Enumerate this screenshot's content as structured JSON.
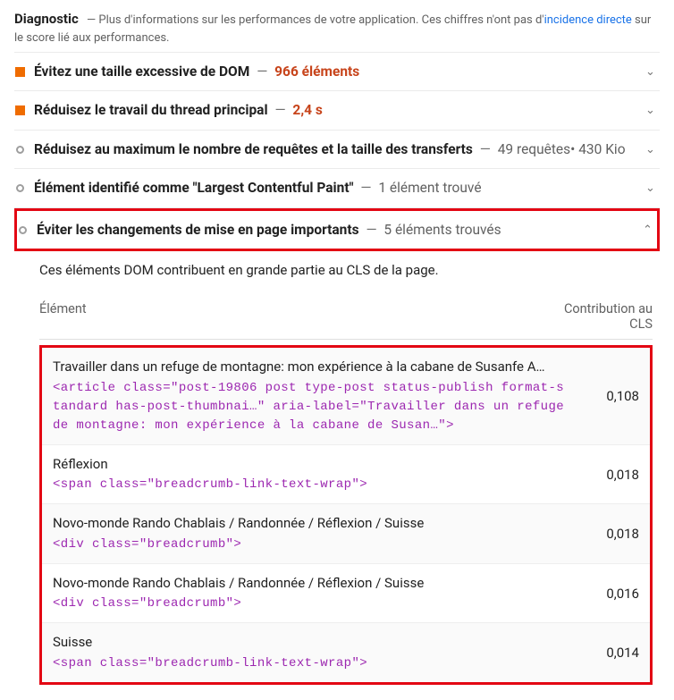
{
  "header": {
    "title": "Diagnostic",
    "sep": "—",
    "text_a": "Plus d'informations sur les performances de votre application. Ces chiffres n'ont pas d'",
    "link": "incidence directe",
    "text_b": " sur le score lié aux performances."
  },
  "audits": {
    "a0": {
      "title": "Évitez une taille excessive de DOM",
      "dash": "—",
      "metric": "966 éléments"
    },
    "a1": {
      "title": "Réduisez le travail du thread principal",
      "dash": "—",
      "metric": "2,4 s"
    },
    "a2": {
      "title": "Réduisez au maximum le nombre de requêtes et la taille des transferts",
      "dash": "—",
      "detail": "49 requêtes• 430 Kio"
    },
    "a3": {
      "title": "Élément identifié comme \"Largest Contentful Paint\"",
      "dash": "—",
      "detail": "1 élément trouvé"
    },
    "a4": {
      "title": "Éviter les changements de mise en page importants",
      "dash": "—",
      "detail": "5 éléments trouvés"
    }
  },
  "description": "Ces éléments DOM contribuent en grande partie au CLS de la page.",
  "table": {
    "col_left": "Élément",
    "col_right": "Contribution au CLS",
    "rows": {
      "r0": {
        "label": "Travailler dans un refuge de montagne: mon expérience à la cabane de Susanfe A…",
        "code": "<article class=\"post-19806 post type-post status-publish format-standard has-post-thumbnai…\" aria-label=\"Travailler dans un refuge de montagne: mon expérience à la cabane de Susan…\">",
        "value": "0,108"
      },
      "r1": {
        "label": "Réflexion",
        "code": "<span class=\"breadcrumb-link-text-wrap\">",
        "value": "0,018"
      },
      "r2": {
        "label": "Novo-monde Rando Chablais / Randonnée / Réflexion / Suisse",
        "code": "<div class=\"breadcrumb\">",
        "value": "0,018"
      },
      "r3": {
        "label": "Novo-monde Rando Chablais / Randonnée / Réflexion / Suisse",
        "code": "<div class=\"breadcrumb\">",
        "value": "0,016"
      },
      "r4": {
        "label": "Suisse",
        "code": "<span class=\"breadcrumb-link-text-wrap\">",
        "value": "0,014"
      }
    }
  }
}
